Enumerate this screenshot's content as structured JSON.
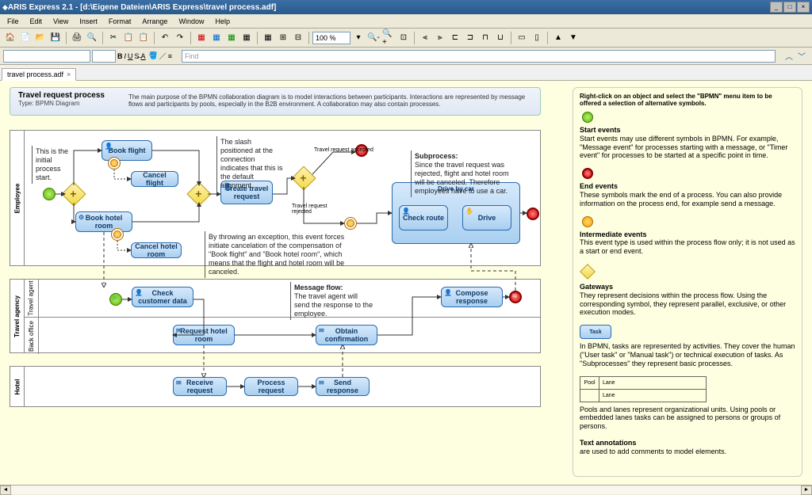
{
  "app": {
    "title": "ARIS Express 2.1 - [d:\\Eigene Dateien\\ARIS Express\\travel process.adf]",
    "min": "_",
    "max": "□",
    "close": "×"
  },
  "menu": [
    "File",
    "Edit",
    "View",
    "Insert",
    "Format",
    "Arrange",
    "Window",
    "Help"
  ],
  "toolbar": {
    "zoom": "100 %",
    "find_placeholder": "Find"
  },
  "tab": {
    "name": "travel process.adf",
    "close": "×"
  },
  "header": {
    "title": "Travel request process",
    "type": "Type: BPMN Diagram",
    "desc": "The main purpose of the BPMN collaboration diagram is to model interactions between participants. Interactions are represented by message flows and participants by pools, especially in the B2B environment. A collaboration may also contain processes."
  },
  "pools": {
    "employee": "Employee",
    "agency": "Travel agency",
    "agency_lane1": "Travel agent",
    "agency_lane2": "Back office",
    "hotel": "Hotel"
  },
  "tasks": {
    "book_flight": "Book flight",
    "cancel_flight": "Cancel flight",
    "book_hotel": "Book hotel room",
    "cancel_hotel": "Cancel hotel room",
    "create_travel": "Create travel request",
    "drive_by_car": "Drive by car",
    "check_route": "Check route",
    "drive": "Drive",
    "check_customer": "Check customer data",
    "request_hotel": "Request hotel room",
    "obtain_conf": "Obtain confirmation",
    "compose_resp": "Compose response",
    "receive_req": "Receive request",
    "process_req": "Process request",
    "send_resp": "Send response"
  },
  "annots": {
    "initial": "This is the initial process start.",
    "slash": "The slash positioned at the connection indicates that this is the default alignment.",
    "accepted": "Travel request accepted",
    "rejected": "Travel request rejected",
    "subprocess_t": "Subprocess:",
    "subprocess": "Since the travel request was rejected, flight and hotel room will be canceled. Therefore employees have to use a car.",
    "exception": "By throwing an exception, this event forces initiate cancelation of the compensation of \"Book flight\" and \"Book hotel room\", which means that the flight and hotel room will be canceled.",
    "exception_b1": "initiate cancelation of",
    "exception_b2": "flight and hotel room",
    "msgflow_t": "Message flow:",
    "msgflow": "The travel agent will send the response to the employee."
  },
  "legend": {
    "head": "Right-click on an object and select the \"BPMN\" menu item to be offered a selection of alternative symbols.",
    "start_t": "Start events",
    "start": "Start events may use different symbols in BPMN. For example, \"Message event\" for processes starting with a message, or \"Timer event\" for processes to be started at a specific point in time.",
    "end_t": "End events",
    "end": "These symbols mark the end of a process. You can also provide information on the process end, for example send a message.",
    "inter_t": "Intermediate events",
    "inter": "This event type is used within the process flow only; it is not used as a start or end event.",
    "gate_t": "Gateways",
    "gate": "They represent decisions within the process flow. Using the corresponding symbol, they represent parallel, exclusive, or other execution modes.",
    "task_label": "Task",
    "task": "In BPMN, tasks are represented by activities. They cover the human (\"User task\" or \"Manual task\") or technical execution of tasks. As \"Subprocesses\" they represent basic processes.",
    "pool": "Pool",
    "lane": "Lane",
    "pool_desc": "Pools and lanes represent organizational units. Using pools or embedded lanes tasks can be assigned to persons or groups of persons.",
    "text_t": "Text annotations",
    "text": "are used to add comments to model elements."
  }
}
